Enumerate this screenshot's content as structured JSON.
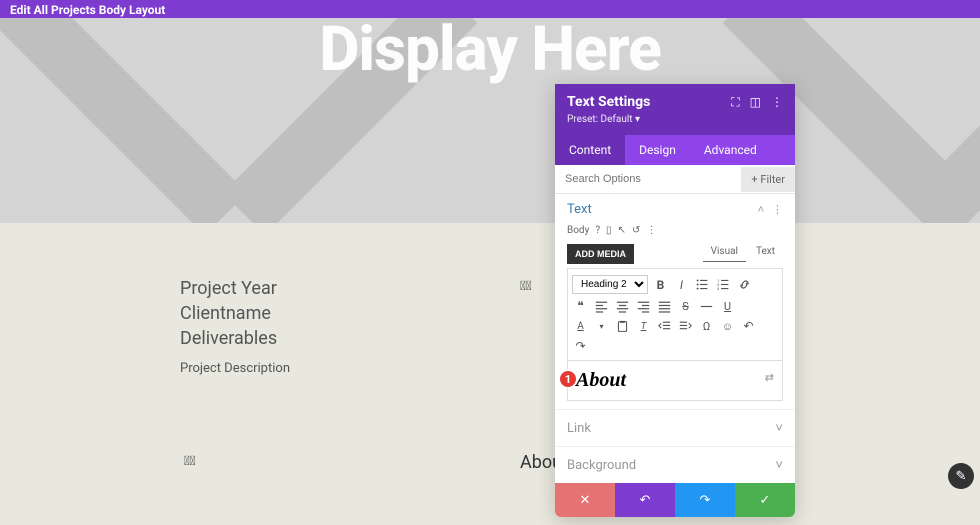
{
  "topBar": {
    "title": "Edit All Projects Body Layout"
  },
  "hero": {
    "text": "Display Here"
  },
  "project": {
    "year": "Project Year",
    "client": "Clientname",
    "deliverables": "Deliverables",
    "description": "Project Description"
  },
  "aboutBottom": "Abou",
  "panel": {
    "title": "Text Settings",
    "preset": "Preset: Default ▾",
    "tabs": {
      "content": "Content",
      "design": "Design",
      "advanced": "Advanced"
    },
    "searchPlaceholder": "Search Options",
    "filter": "Filter",
    "textSection": {
      "title": "Text",
      "bodyLabel": "Body",
      "addMedia": "ADD MEDIA",
      "visualTab": "Visual",
      "textTab": "Text",
      "headingSel": "Heading 2",
      "content": "About"
    },
    "linkSection": "Link",
    "bgSection": "Background",
    "marker": "1"
  },
  "icons": {
    "expand": "⛶",
    "columns": "◫",
    "more": "⋮",
    "plus": "+",
    "chevUp": "˄",
    "chevDown": "˅",
    "help": "?",
    "mobile": "▯",
    "cursor": "↖",
    "reset": "↺",
    "bold": "B",
    "italic": "I",
    "quote": "❝",
    "times": "✕",
    "undo": "↶",
    "redo": "↷",
    "check": "✓",
    "wrench": "✎",
    "dyn": "⇄"
  }
}
